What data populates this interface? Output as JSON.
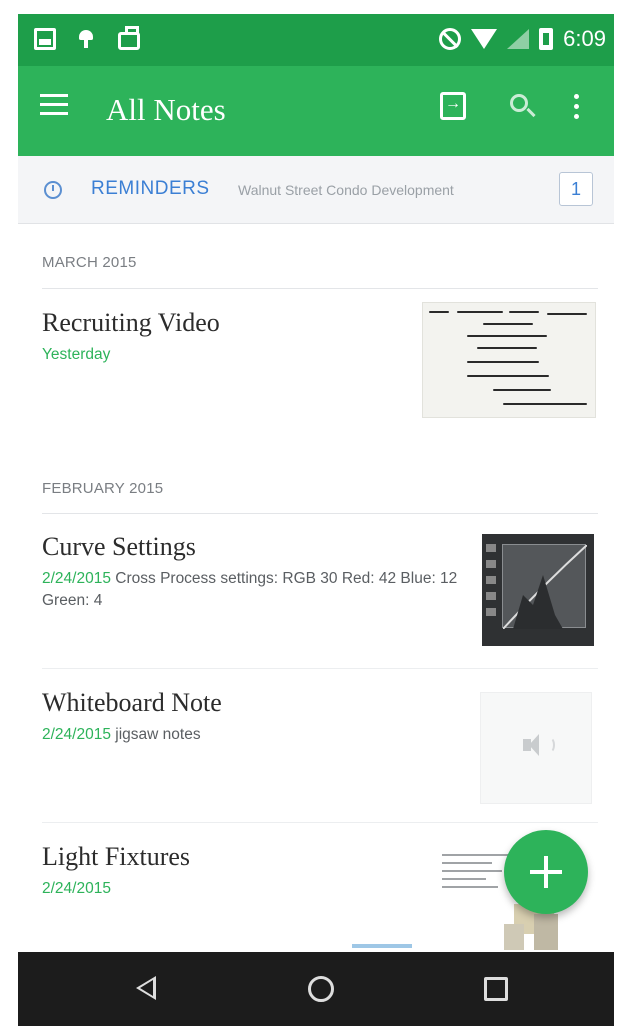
{
  "status_bar": {
    "time": "6:09",
    "left_icons": [
      "gallery-icon",
      "android-icon",
      "shopping-bag-icon"
    ],
    "right_icons": [
      "do-not-disturb-icon",
      "wifi-icon",
      "signal-icon",
      "battery-icon"
    ]
  },
  "app_bar": {
    "title": "All Notes",
    "actions": [
      "sync-icon",
      "search-icon",
      "more-vert-icon"
    ],
    "color": "#2db35a"
  },
  "reminders": {
    "label": "REMINDERS",
    "preview": "Walnut Street Condo Development",
    "count": "1"
  },
  "sections": [
    {
      "header": "MARCH 2015",
      "notes": [
        {
          "title": "Recruiting Video",
          "date": "Yesterday",
          "snippet": ""
        }
      ]
    },
    {
      "header": "FEBRUARY 2015",
      "notes": [
        {
          "title": "Curve Settings",
          "date": "2/24/2015",
          "snippet": "Cross Process settings: RGB 30 Red: 42 Blue: 12 Green: 4"
        },
        {
          "title": "Whiteboard Note",
          "date": "2/24/2015",
          "snippet": "jigsaw notes"
        },
        {
          "title": "Light Fixtures",
          "date": "2/24/2015",
          "snippet": ""
        }
      ]
    }
  ],
  "fab": {
    "icon": "plus-icon"
  },
  "nav_bar": {
    "icons": [
      "back-icon",
      "home-icon",
      "recents-icon"
    ]
  },
  "colors": {
    "accent": "#2db35a",
    "link": "#3b7fd4",
    "date": "#2db35a"
  }
}
